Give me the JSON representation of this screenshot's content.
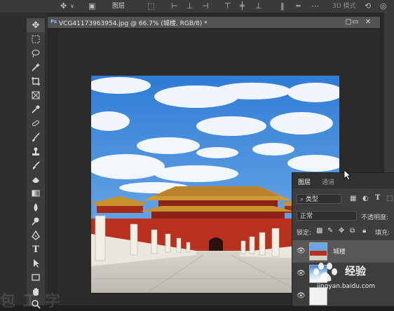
{
  "options_bar": {
    "show_transform_controls_label": "图层",
    "mode_3d_label": "3D 模式"
  },
  "document": {
    "tab_title": "VCG41173963954.jpg @ 66.7% (城楼, RGB/8) *",
    "ps_icon": "Ps",
    "minimize_glyph": "▭",
    "restore_glyph": "▢",
    "close_glyph": "✕"
  },
  "layers_panel": {
    "tabs": [
      {
        "label": "图层",
        "active": true
      },
      {
        "label": "通道",
        "active": false
      }
    ],
    "filter_kind": "类型",
    "blend_mode": "正常",
    "opacity_label": "不透明度:",
    "lock_label": "锁定:",
    "fill_label": "填充:",
    "layers": [
      {
        "name": "城楼",
        "visible": true,
        "selected": true
      },
      {
        "name": "",
        "visible": true,
        "selected": false
      },
      {
        "name": "",
        "visible": true,
        "selected": false
      }
    ]
  },
  "watermark": {
    "brand": "Baidu",
    "text_big": "经验",
    "text_small": "jingyan.baidu.com"
  },
  "bottom_faded_text": "包工字",
  "colors": {
    "panel_bg": "#3d3d3d",
    "toolbar_bg": "#3c3c3c",
    "canvas_bg": "#2b2b2b",
    "sky": "#4a8fd8",
    "palace_wall": "#b8311f",
    "roof_gold": "#c8932c"
  }
}
